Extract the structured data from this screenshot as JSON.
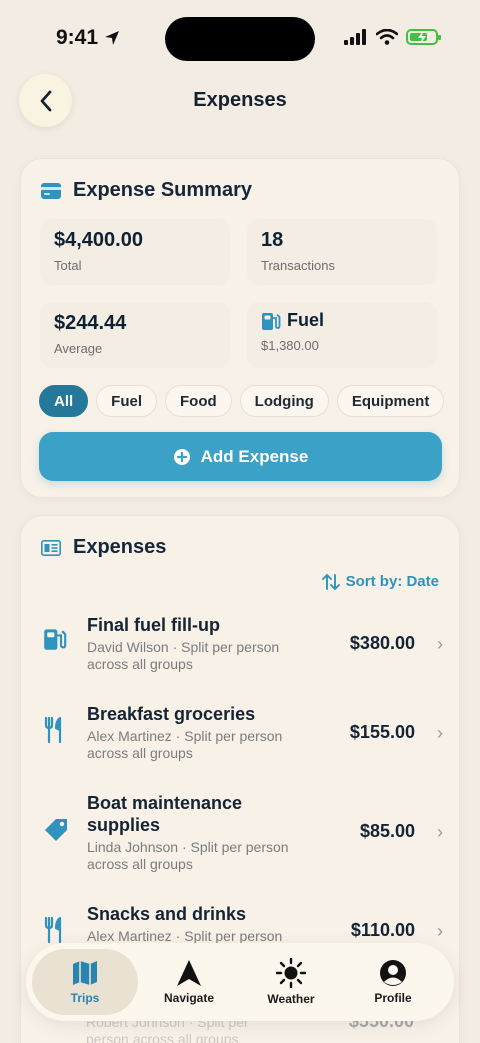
{
  "status_bar": {
    "time": "9:41"
  },
  "header": {
    "title": "Expenses"
  },
  "summary": {
    "title": "Expense Summary",
    "total_value": "$4,400.00",
    "total_label": "Total",
    "transactions_value": "18",
    "transactions_label": "Transactions",
    "average_value": "$244.44",
    "average_label": "Average",
    "top_category_name": "Fuel",
    "top_category_value": "$1,380.00",
    "filters": [
      "All",
      "Fuel",
      "Food",
      "Lodging",
      "Equipment"
    ],
    "add_label": "Add Expense"
  },
  "expenses": {
    "title": "Expenses",
    "sort_label": "Sort by: Date",
    "items": [
      {
        "title": "Final fuel fill-up",
        "sub1": "David Wilson · Split per person",
        "sub2": "across all groups",
        "amount": "$380.00",
        "icon": "fuel-pump-icon"
      },
      {
        "title": "Breakfast groceries",
        "sub1": "Alex Martinez · Split per person",
        "sub2": "across all groups",
        "amount": "$155.00",
        "icon": "fork-knife-icon"
      },
      {
        "title": "Boat maintenance",
        "title2": "supplies",
        "sub1": "Linda Johnson · Split per person",
        "sub2": "across all groups",
        "amount": "$85.00",
        "icon": "tag-icon"
      },
      {
        "title": "Snacks and drinks",
        "sub1": "Alex Martinez · Split per person",
        "amount": "$110.00",
        "icon": "fork-knife-icon"
      },
      {
        "sub1": "Robert Johnson · Split per",
        "sub2": "person across all groups",
        "amount": "$550.00"
      }
    ]
  },
  "tabbar": {
    "tabs": [
      {
        "label": "Trips",
        "icon": "map-icon"
      },
      {
        "label": "Navigate",
        "icon": "navigation-arrow-icon"
      },
      {
        "label": "Weather",
        "icon": "sun-icon"
      },
      {
        "label": "Profile",
        "icon": "profile-icon"
      }
    ]
  },
  "colors": {
    "accent": "#3ba1c6",
    "accent_dark": "#24789a",
    "background": "#f2ece3"
  },
  "battery_level": 0.7
}
